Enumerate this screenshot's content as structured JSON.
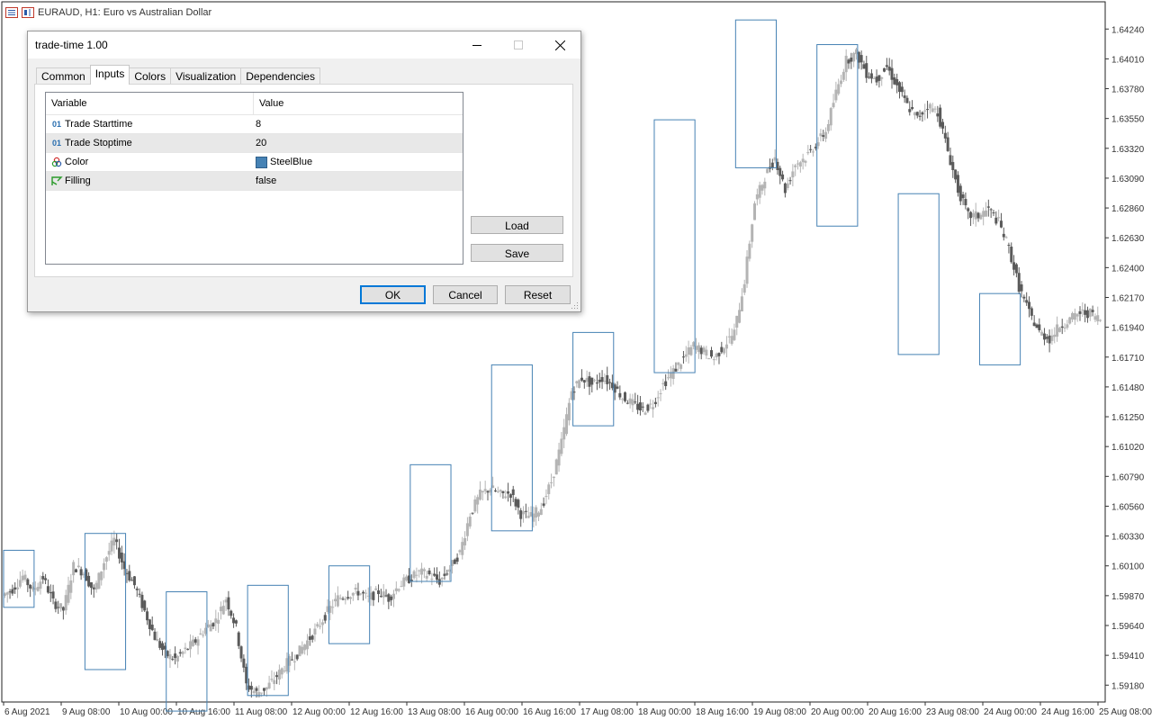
{
  "chart": {
    "title": "EURAUD, H1:  Euro vs Australian Dollar",
    "y_ticks": [
      "1.64240",
      "1.64010",
      "1.63780",
      "1.63550",
      "1.63320",
      "1.63090",
      "1.62860",
      "1.62630",
      "1.62400",
      "1.62170",
      "1.61940",
      "1.61710",
      "1.61480",
      "1.61250",
      "1.61020",
      "1.60790",
      "1.60560",
      "1.60330",
      "1.60100",
      "1.59870",
      "1.59640",
      "1.59410",
      "1.59180"
    ],
    "x_ticks": [
      "6 Aug 2021",
      "9 Aug 08:00",
      "10 Aug 00:00",
      "10 Aug 16:00",
      "11 Aug 08:00",
      "12 Aug 00:00",
      "12 Aug 16:00",
      "13 Aug 08:00",
      "16 Aug 00:00",
      "16 Aug 16:00",
      "17 Aug 08:00",
      "18 Aug 00:00",
      "18 Aug 16:00",
      "19 Aug 08:00",
      "20 Aug 00:00",
      "20 Aug 16:00",
      "23 Aug 08:00",
      "24 Aug 00:00",
      "24 Aug 16:00",
      "25 Aug 08:00"
    ],
    "box_color": "#4682b4",
    "candle_color": "#b4b4b4",
    "bear_color": "#5a5a5a"
  },
  "chart_data": {
    "type": "candlestick",
    "symbol": "EURAUD",
    "timeframe": "H1",
    "ylim": [
      1.5905,
      1.6445
    ],
    "path_y": [
      1.5987,
      1.5992,
      1.6002,
      1.5991,
      1.6001,
      1.5982,
      1.5976,
      1.601,
      1.6005,
      1.599,
      1.6013,
      1.603,
      1.6008,
      1.5995,
      1.5975,
      1.5955,
      1.5942,
      1.5938,
      1.5945,
      1.5952,
      1.5962,
      1.5968,
      1.5985,
      1.5962,
      1.5918,
      1.5912,
      1.5916,
      1.5925,
      1.5935,
      1.5942,
      1.5952,
      1.5962,
      1.5975,
      1.5985,
      1.5988,
      1.599,
      1.5985,
      1.599,
      1.5985,
      1.5995,
      1.6,
      1.6005,
      1.6003,
      1.5998,
      1.6008,
      1.602,
      1.605,
      1.6065,
      1.607,
      1.6065,
      1.6066,
      1.605,
      1.6048,
      1.6055,
      1.6075,
      1.6105,
      1.6145,
      1.6155,
      1.615,
      1.6155,
      1.615,
      1.614,
      1.6135,
      1.613,
      1.6135,
      1.615,
      1.616,
      1.617,
      1.618,
      1.6175,
      1.617,
      1.618,
      1.619,
      1.623,
      1.629,
      1.631,
      1.6325,
      1.63,
      1.632,
      1.6325,
      1.6335,
      1.6345,
      1.6375,
      1.64,
      1.6405,
      1.639,
      1.6385,
      1.6395,
      1.638,
      1.6365,
      1.6355,
      1.6365,
      1.636,
      1.633,
      1.63,
      1.628,
      1.628,
      1.6285,
      1.6275,
      1.6255,
      1.6225,
      1.6205,
      1.619,
      1.6185,
      1.6195,
      1.62,
      1.6205,
      1.6205,
      1.62
    ],
    "session_boxes": [
      {
        "start": 0,
        "end": 3,
        "high": 1.6022,
        "low": 1.5978
      },
      {
        "start": 8,
        "end": 12,
        "high": 1.6035,
        "low": 1.593
      },
      {
        "start": 16,
        "end": 20,
        "high": 1.599,
        "low": 1.5898
      },
      {
        "start": 24,
        "end": 28,
        "high": 1.5995,
        "low": 1.591
      },
      {
        "start": 32,
        "end": 36,
        "high": 1.601,
        "low": 1.595
      },
      {
        "start": 40,
        "end": 44,
        "high": 1.6088,
        "low": 1.5998
      },
      {
        "start": 48,
        "end": 52,
        "high": 1.6165,
        "low": 1.6037
      },
      {
        "start": 56,
        "end": 60,
        "high": 1.619,
        "low": 1.6118
      },
      {
        "start": 64,
        "end": 68,
        "high": 1.6354,
        "low": 1.6159
      },
      {
        "start": 72,
        "end": 76,
        "high": 1.6431,
        "low": 1.6317
      },
      {
        "start": 80,
        "end": 84,
        "high": 1.6412,
        "low": 1.6272
      },
      {
        "start": 88,
        "end": 92,
        "high": 1.6297,
        "low": 1.6173
      },
      {
        "start": 96,
        "end": 100,
        "high": 1.622,
        "low": 1.6165
      }
    ]
  },
  "dialog": {
    "title": "trade-time 1.00",
    "tabs": [
      "Common",
      "Inputs",
      "Colors",
      "Visualization",
      "Dependencies"
    ],
    "active_tab": "Inputs",
    "columns": {
      "variable": "Variable",
      "value": "Value"
    },
    "rows": [
      {
        "variable": "Trade Starttime",
        "value": "8",
        "icon": "integer-icon"
      },
      {
        "variable": "Trade Stoptime",
        "value": "20",
        "icon": "integer-icon"
      },
      {
        "variable": "Color",
        "value": "SteelBlue",
        "icon": "color-icon",
        "swatch": "#4682b4"
      },
      {
        "variable": "Filling",
        "value": "false",
        "icon": "boolean-icon"
      }
    ],
    "load_label": "Load",
    "save_label": "Save",
    "ok_label": "OK",
    "cancel_label": "Cancel",
    "reset_label": "Reset"
  }
}
